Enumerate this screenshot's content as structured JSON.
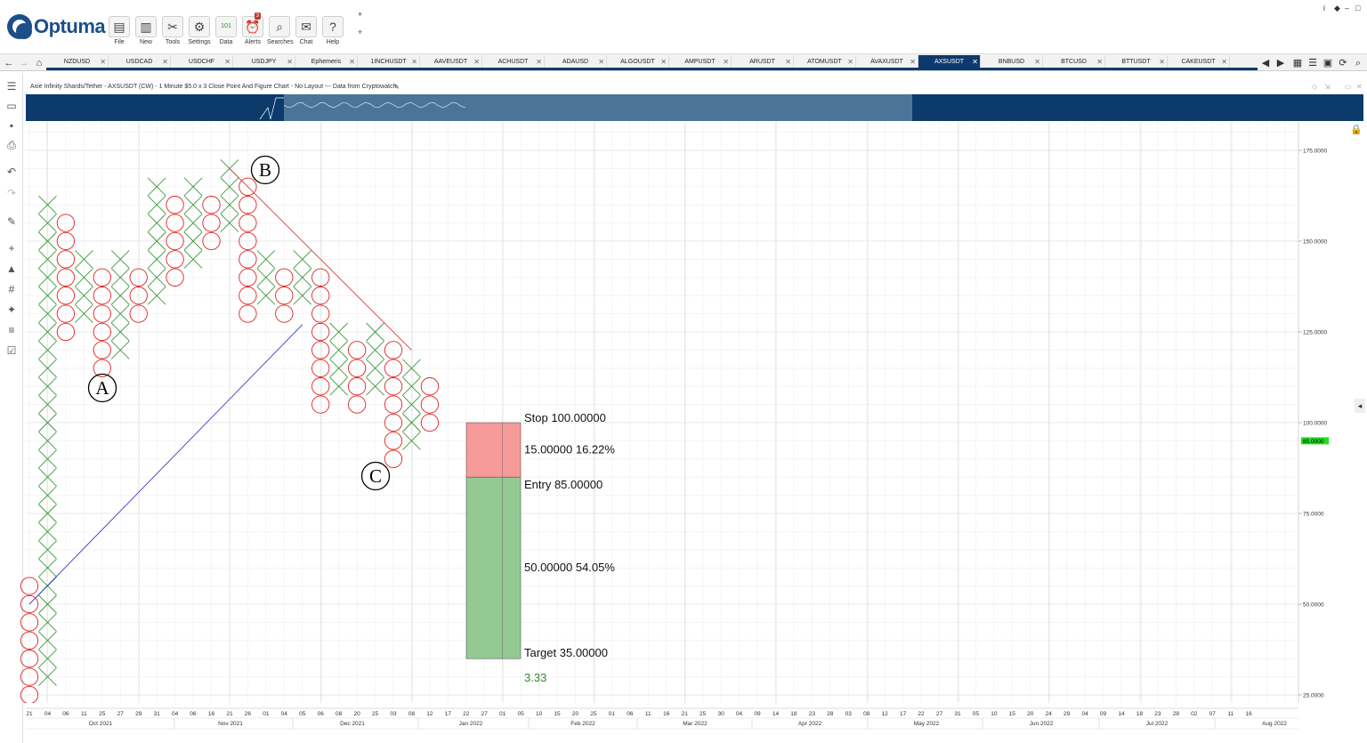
{
  "app": {
    "logo": "Optuma",
    "toolbar": [
      {
        "label": "File",
        "icon": "folder-icon"
      },
      {
        "label": "New",
        "icon": "new-icon"
      },
      {
        "label": "Tools",
        "icon": "tools-icon"
      },
      {
        "label": "Settings",
        "icon": "settings-icon"
      },
      {
        "label": "Data",
        "icon": "data-icon",
        "glyph": "101"
      },
      {
        "label": "Alerts",
        "icon": "alarm-icon",
        "badge": "3"
      },
      {
        "label": "Searches",
        "icon": "search-icon"
      },
      {
        "label": "Chat",
        "icon": "chat-icon"
      },
      {
        "label": "Help",
        "icon": "help-icon",
        "glyph": "?"
      }
    ],
    "window_controls": [
      "i",
      "◆",
      "–",
      "□",
      "✕"
    ]
  },
  "tabs": [
    "NZDUSD",
    "USDCAD",
    "USDCHF",
    "USDJPY",
    "Ephemeris",
    "1INCHUSDT",
    "AAVEUSDT",
    "ACHUSDT",
    "ADAUSD",
    "ALGOUSDT",
    "AMPUSDT",
    "ARUSDT",
    "ATOMUSDT",
    "AVAXUSDT",
    "AXSUSDT",
    "BNBUSD",
    "BTCUSD",
    "BTTUSDT",
    "CAKEUSDT"
  ],
  "active_tab": "AXSUSDT",
  "chart_title": "Axie Infinity Shards/Tether - AXSUSDT (CW) - 1 Minute $5.0 x 3 Close Point And Figure Chart - No Layout --- Data from Cryptowatch",
  "chart_data": {
    "type": "point-and-figure",
    "box_size": 5.0,
    "reversal": 3,
    "ylim": [
      20,
      180
    ],
    "y_ticks": [
      25,
      50,
      75,
      100,
      125,
      150,
      175
    ],
    "y_tick_labels": [
      "25.0000",
      "50.0000",
      "75.0000",
      "100.0000",
      "125.0000",
      "150.0000",
      "175.0000"
    ],
    "last_price_label": "85.0000",
    "columns": [
      {
        "type": "O",
        "high": 55,
        "low": 25
      },
      {
        "type": "X",
        "high": 160,
        "low": 30
      },
      {
        "type": "O",
        "high": 155,
        "low": 125
      },
      {
        "type": "X",
        "high": 145,
        "low": 130
      },
      {
        "type": "O",
        "high": 140,
        "low": 115
      },
      {
        "type": "X",
        "high": 145,
        "low": 120
      },
      {
        "type": "O",
        "high": 140,
        "low": 130
      },
      {
        "type": "X",
        "high": 165,
        "low": 135
      },
      {
        "type": "O",
        "high": 160,
        "low": 140
      },
      {
        "type": "X",
        "high": 165,
        "low": 145
      },
      {
        "type": "O",
        "high": 160,
        "low": 150
      },
      {
        "type": "X",
        "high": 170,
        "low": 155
      },
      {
        "type": "O",
        "high": 165,
        "low": 130
      },
      {
        "type": "X",
        "high": 145,
        "low": 135
      },
      {
        "type": "O",
        "high": 140,
        "low": 130
      },
      {
        "type": "X",
        "high": 145,
        "low": 135
      },
      {
        "type": "O",
        "high": 140,
        "low": 105
      },
      {
        "type": "X",
        "high": 125,
        "low": 110
      },
      {
        "type": "O",
        "high": 120,
        "low": 105
      },
      {
        "type": "X",
        "high": 125,
        "low": 110
      },
      {
        "type": "O",
        "high": 120,
        "low": 90
      },
      {
        "type": "X",
        "high": 115,
        "low": 95
      },
      {
        "type": "O",
        "high": 110,
        "low": 100
      }
    ],
    "x_tick_labels": [
      "21",
      "04",
      "06",
      "11",
      "25",
      "27",
      "29",
      "31",
      "04",
      "06",
      "16",
      "21",
      "26",
      "01",
      "04",
      "05",
      "06",
      "08",
      "20",
      "25",
      "03",
      "08",
      "12",
      "17",
      "22",
      "27",
      "01",
      "05",
      "10",
      "15",
      "20",
      "25",
      "01",
      "06",
      "11",
      "16",
      "21",
      "25",
      "30",
      "04",
      "09",
      "14",
      "18",
      "23",
      "28",
      "03",
      "08",
      "12",
      "17",
      "22",
      "27",
      "31",
      "05",
      "10",
      "15",
      "20",
      "24",
      "29",
      "04",
      "09",
      "14",
      "18",
      "23",
      "28",
      "02",
      "07",
      "11",
      "16"
    ],
    "month_labels": [
      "Oct 2021",
      "Nov 2021",
      "Dec 2021",
      "Jan 2022",
      "Feb 2022",
      "Mar 2022",
      "Apr 2022",
      "May 2022",
      "Jun 2022",
      "Jul 2022",
      "Aug 2022"
    ],
    "annotations": [
      "A",
      "B",
      "C"
    ],
    "trendlines": [
      {
        "name": "resistance",
        "color": "#e53935",
        "from": {
          "col": 11,
          "price": 170
        },
        "to": {
          "col": 21,
          "price": 120
        }
      },
      {
        "name": "support",
        "color": "#3b3bd1",
        "from": {
          "col": 0,
          "price": 50
        },
        "to": {
          "col": 15,
          "price": 127
        }
      }
    ],
    "risk_reward": {
      "stop_label": "Stop 100.00000",
      "risk_label": "15.00000 16.22%",
      "entry_label": "Entry 85.00000",
      "reward_label": "50.00000 54.05%",
      "target_label": "Target 35.00000",
      "ratio_label": "3.33",
      "stop": 100,
      "entry": 85,
      "target": 35,
      "risk_color": "#f79a9a",
      "reward_color": "#93c993"
    },
    "grid": true,
    "colors": {
      "x": "#3a9a3a",
      "o": "#e02424",
      "header": "#0b3a6b",
      "nav_window": "#4c7499"
    }
  }
}
